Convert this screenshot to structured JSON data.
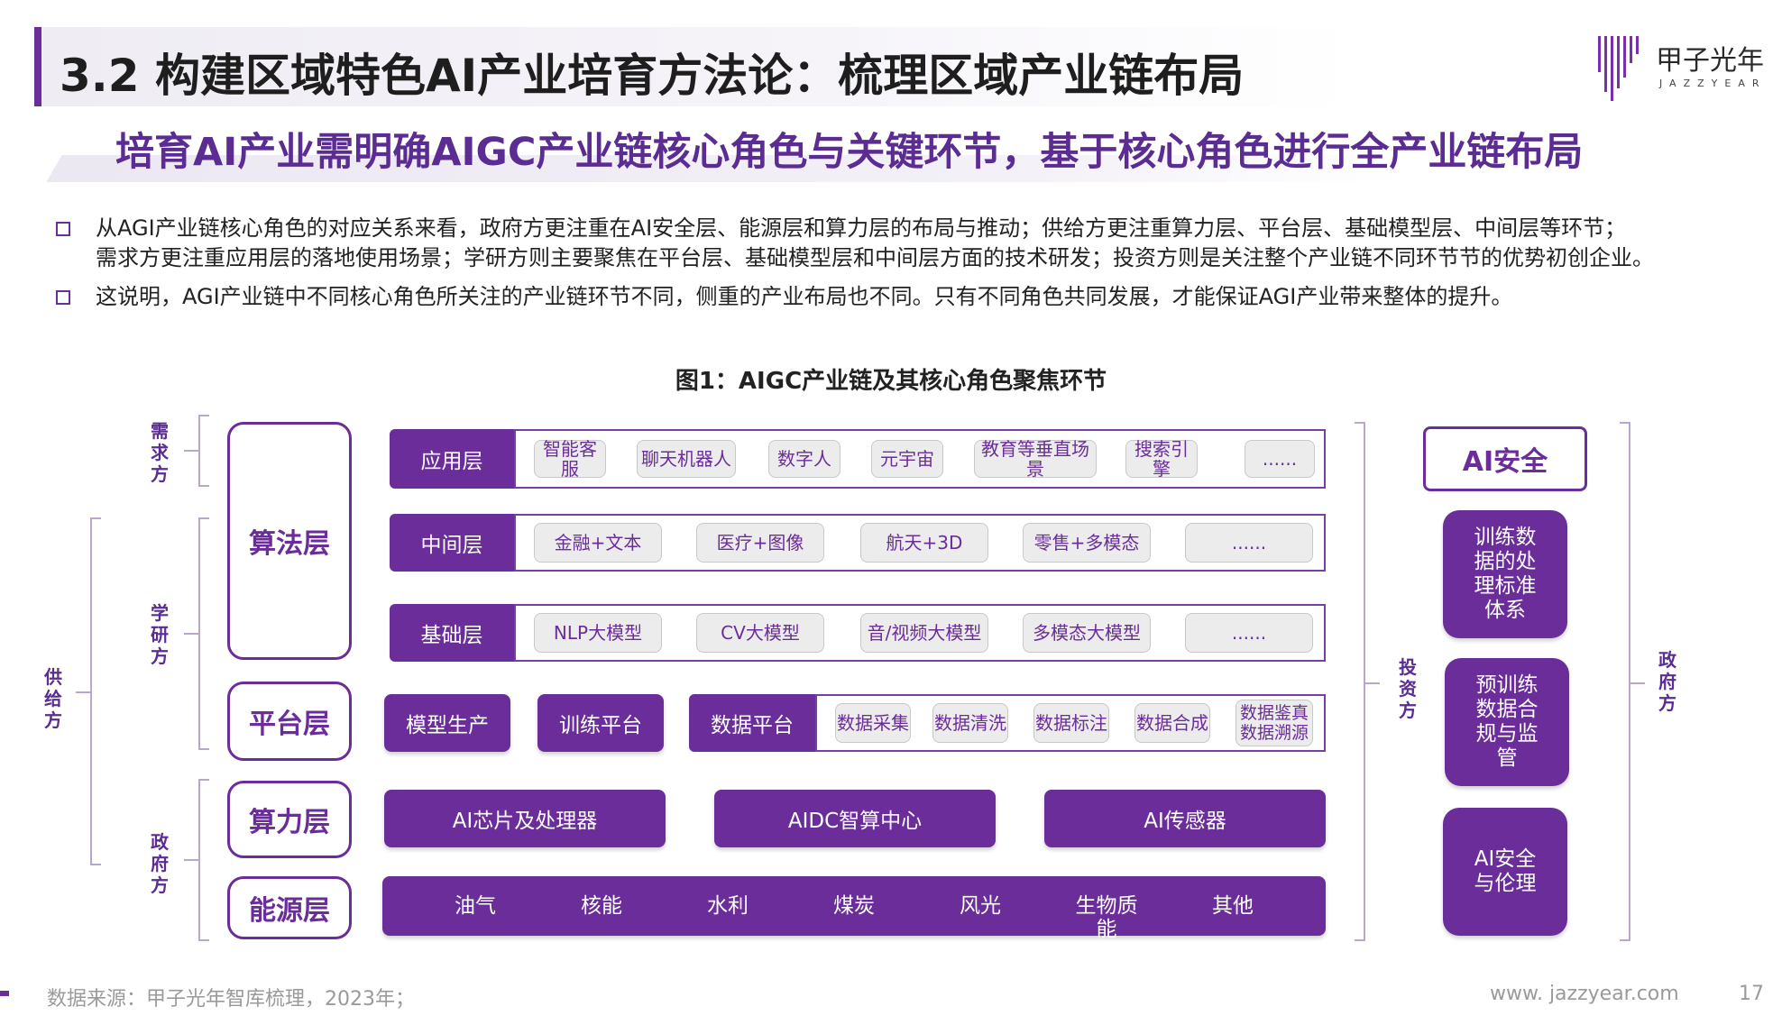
{
  "header": {
    "title": "3.2 构建区域特色AI产业培育方法论：梳理区域产业链布局",
    "logo_cn": "甲子光年",
    "logo_en": "JAZZYEAR"
  },
  "subtitle": "培育AI产业需明确AIGC产业链核心角色与关键环节，基于核心角色进行全产业链布局",
  "bullets": [
    "从AGI产业链核心角色的对应关系来看，政府方更注重在AI安全层、能源层和算力层的布局与推动；供给方更注重算力层、平台层、基础模型层、中间层等环节；\n需求方更注重应用层的落地使用场景；学研方则主要聚焦在平台层、基础模型层和中间层方面的技术研发；投资方则是关注整个产业链不同环节节的优势初创企业。",
    "这说明，AGI产业链中不同核心角色所关注的产业链环节不同，侧重的产业布局也不同。只有不同角色共同发展，才能保证AGI产业带来整体的提升。"
  ],
  "figure": {
    "title": "图1：AIGC产业链及其核心角色聚焦环节",
    "roles_left": {
      "demand": "需求方",
      "academic": "学研方",
      "supply": "供给方",
      "government": "政府方"
    },
    "roles_right": {
      "investment": "投资方",
      "government": "政府方"
    },
    "layers": {
      "algorithm": "算法层",
      "platform": "平台层",
      "compute": "算力层",
      "energy": "能源层"
    },
    "rows": {
      "application": {
        "label": "应用层",
        "items": [
          "智能客服",
          "聊天机器人",
          "数字人",
          "元宇宙",
          "教育等垂直场景",
          "搜索引擎",
          "......"
        ]
      },
      "middle": {
        "label": "中间层",
        "items": [
          "金融+文本",
          "医疗+图像",
          "航天+3D",
          "零售+多模态",
          "......"
        ]
      },
      "foundation": {
        "label": "基础层",
        "items": [
          "NLP大模型",
          "CV大模型",
          "音/视频大模型",
          "多模态大模型",
          "......"
        ]
      }
    },
    "platform": {
      "model_production": "模型生产",
      "training_platform": "训练平台",
      "data_platform": "数据平台",
      "data_items": [
        "数据采集",
        "数据清洗",
        "数据标注",
        "数据合成",
        "数据鉴真\n数据溯源"
      ]
    },
    "compute": [
      "AI芯片及处理器",
      "AIDC智算中心",
      "AI传感器"
    ],
    "energy": [
      "油气",
      "核能",
      "水利",
      "煤炭",
      "风光",
      "生物质\n能",
      "其他"
    ],
    "ai_safety": {
      "title": "AI安全",
      "cards": [
        "训练数\n据的处\n理标准\n体系",
        "预训练\n数据合\n规与监\n管",
        "AI安全\n与伦理"
      ]
    }
  },
  "footer": {
    "source": "数据来源：甲子光年智库梳理，2023年；",
    "url": "www. jazzyear.com",
    "page": "17"
  }
}
